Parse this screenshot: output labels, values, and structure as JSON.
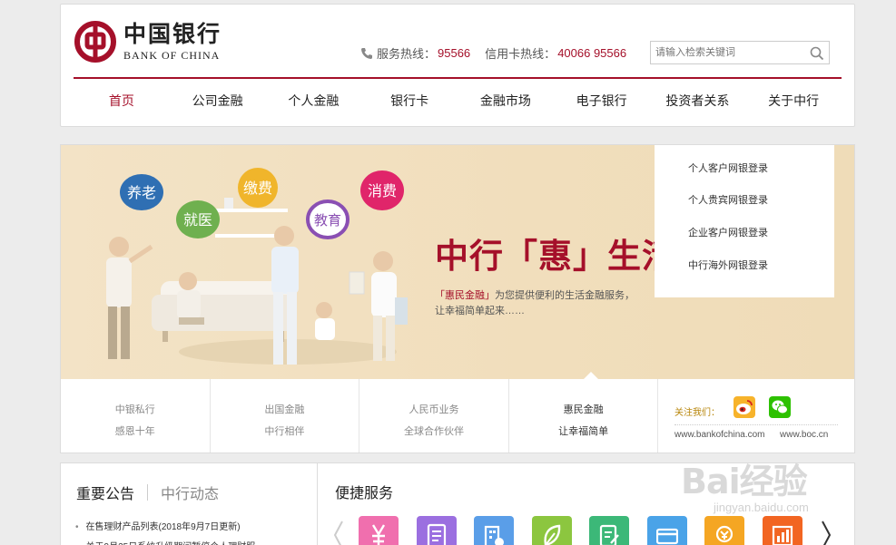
{
  "brand": {
    "cn_name": "中国银行",
    "en_name": "BANK OF CHINA",
    "accent": "#a5102a"
  },
  "hotlines": {
    "service_label": "服务热线：",
    "service_number": "95566",
    "credit_label": "信用卡热线：",
    "credit_number": "40066 95566",
    "icon": "phone-icon"
  },
  "search": {
    "placeholder": "请输入检索关键词",
    "icon": "search-icon"
  },
  "nav": {
    "items": [
      "首页",
      "公司金融",
      "个人金融",
      "银行卡",
      "金融市场",
      "电子银行",
      "投资者关系",
      "关于中行"
    ],
    "active": "首页"
  },
  "banner": {
    "bubbles": [
      "养老",
      "就医",
      "缴费",
      "教育",
      "消费"
    ],
    "slogan": "中行「惠」生活",
    "sub_highlight": "「惠民金融」",
    "sub_line1": "为您提供便利的生活金融服务，",
    "sub_line2": "让幸福简单起来……"
  },
  "login": {
    "items": [
      "个人客户网银登录",
      "个人贵宾网银登录",
      "企业客户网银登录",
      "中行海外网银登录"
    ]
  },
  "tabs": [
    {
      "line1": "中银私行",
      "line2": "感恩十年"
    },
    {
      "line1": "出国金融",
      "line2": "中行相伴"
    },
    {
      "line1": "人民币业务",
      "line2": "全球合作伙伴"
    },
    {
      "line1": "惠民金融",
      "line2": "让幸福简单"
    }
  ],
  "follow": {
    "label": "关注我们：",
    "icons": [
      "weibo-icon",
      "wechat-icon"
    ],
    "link1": "www.bankofchina.com",
    "link2": "www.boc.cn"
  },
  "notice": {
    "tab_active": "重要公告",
    "tab_inactive": "中行动态",
    "items": [
      "在售理财产品列表(2018年9月7日更新)",
      "关于9月25日系统升级期间暂停个人理财服"
    ]
  },
  "services": {
    "title": "便捷服务",
    "icons": [
      {
        "name": "wealth-icon",
        "color": "#f06fae"
      },
      {
        "name": "document-icon",
        "color": "#9b6fe0"
      },
      {
        "name": "branch-icon",
        "color": "#5a9ee8"
      },
      {
        "name": "leaf-icon",
        "color": "#8cc63f"
      },
      {
        "name": "form-icon",
        "color": "#3cb878"
      },
      {
        "name": "card-icon",
        "color": "#4aa3e8"
      },
      {
        "name": "exchange-icon",
        "color": "#f5a623"
      },
      {
        "name": "chart-icon",
        "color": "#f26522"
      }
    ]
  },
  "watermark": {
    "text": "Bai经验",
    "sub": "jingyan.baidu.com"
  }
}
